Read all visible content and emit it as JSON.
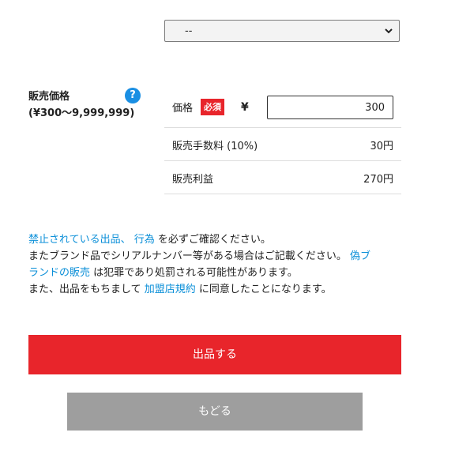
{
  "select": {
    "value": "--"
  },
  "price_section": {
    "title": "販売価格",
    "range": "(¥300〜9,999,999)",
    "help_glyph": "?"
  },
  "price_row": {
    "label": "価格",
    "required_badge": "必須",
    "currency": "¥",
    "value": "300"
  },
  "fee_row": {
    "label": "販売手数料 (10%)",
    "amount": "30円"
  },
  "profit_row": {
    "label": "販売利益",
    "amount": "270円"
  },
  "notice": {
    "line1_link1": "禁止されている出品、",
    "line1_link2": "行為",
    "line1_text": "を必ずご確認ください。",
    "line2_text": "またブランド品でシリアルナンバー等がある場合はご記載ください。",
    "line2_link": "偽ブ",
    "line3_link": "ランドの販売",
    "line3_text": "は犯罪であり処罰される可能性があります。",
    "line4_text_before": "また、出品をもちまして",
    "line4_link": "加盟店規約",
    "line4_text_after": "に同意したことになります。"
  },
  "buttons": {
    "submit": "出品する",
    "back": "もどる"
  },
  "colors": {
    "accent_red": "#e8252b",
    "link_blue": "#0b8fd8",
    "help_blue": "#1a8fe3",
    "back_gray": "#9e9e9e"
  }
}
